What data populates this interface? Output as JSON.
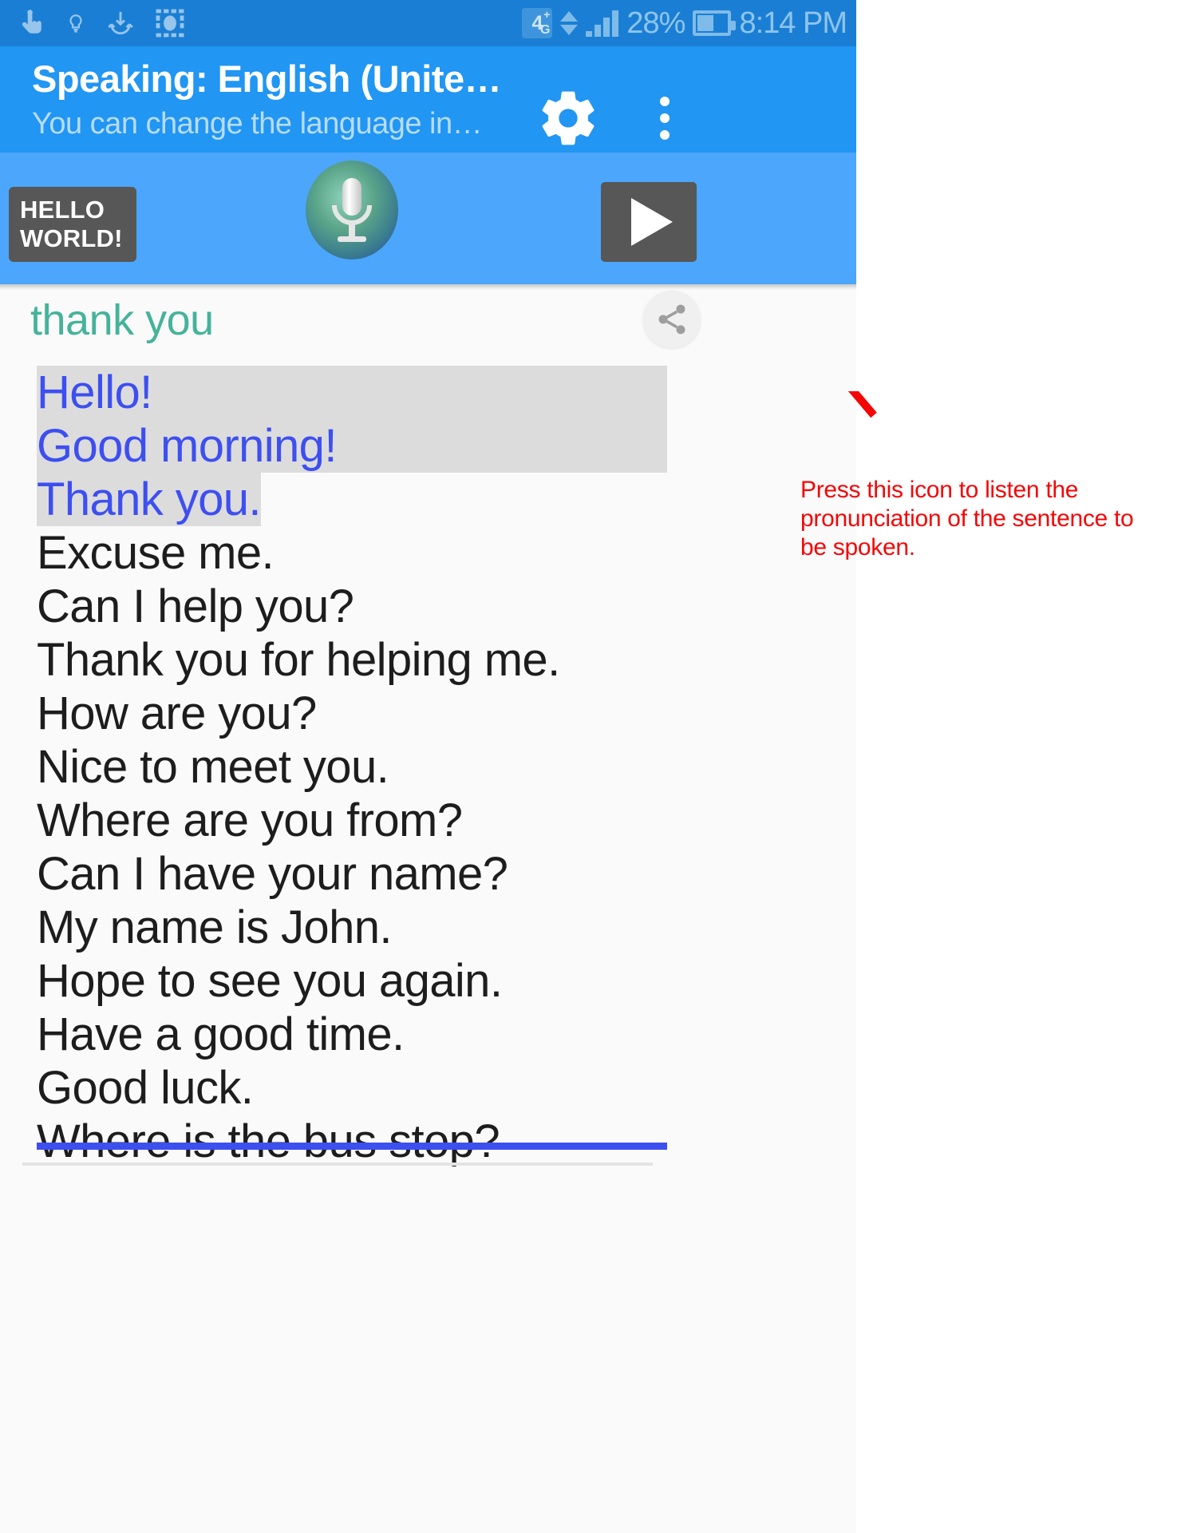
{
  "statusbar": {
    "icons": [
      "touch-pointer-icon",
      "lightbulb-icon",
      "download-sync-icon",
      "screenshot-icon"
    ],
    "network_type": "4",
    "network_suffix_top": "+",
    "network_suffix_bottom": "G",
    "battery_percent": "28%",
    "time": "8:14 PM"
  },
  "appbar": {
    "title": "Speaking: English (Unite…",
    "subtitle": "You can change the language in…",
    "settings_icon": "gear-icon",
    "overflow_icon": "more-vertical-icon"
  },
  "controls": {
    "hello_world_line1": "HELLO",
    "hello_world_line2": "WORLD!",
    "mic_icon": "microphone-icon",
    "play_icon": "play-icon"
  },
  "content": {
    "hint": "thank you",
    "share_icon": "share-icon",
    "selected_lines": [
      "Hello!",
      "Good morning!",
      "Thank you."
    ],
    "lines": [
      "Excuse me.",
      "Can I help you?",
      "Thank you for helping me.",
      "How are you?",
      "Nice to meet you.",
      "Where are you from?",
      "Can I have your name?",
      "My name is John.",
      "Hope to see you again.",
      "Have a good time.",
      "Good luck."
    ],
    "clipped_line": "Where is the bus stop?"
  },
  "annotation": {
    "text": "Press this icon to listen the pronunciation of the sentence to be spoken.",
    "color": "#f40606",
    "arrow": "arrow-pointing-to-play-button"
  },
  "colors": {
    "statusbar_bg": "#1a7fd4",
    "appbar_bg": "#2196f3",
    "controls_bg": "#4ca6fb",
    "content_bg": "#fafafa",
    "hint_green": "#45b39a",
    "selection_blue": "#3d4ff0",
    "selection_bg": "#dcdcdc",
    "button_gray": "#575757",
    "annotation_red": "#f40606"
  }
}
